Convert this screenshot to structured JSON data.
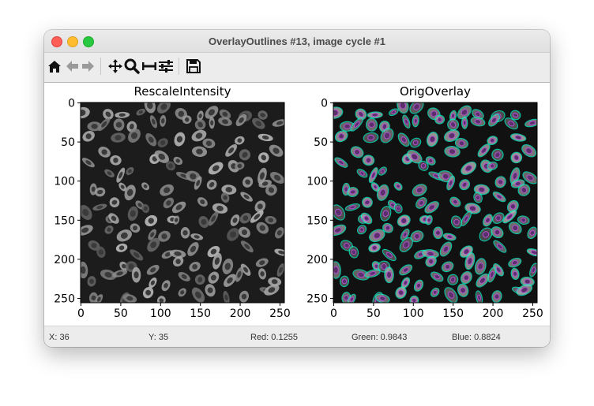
{
  "window": {
    "title": "OverlayOutlines #13, image cycle #1"
  },
  "toolbar": {
    "buttons": [
      {
        "name": "home-icon",
        "label": "Home"
      },
      {
        "name": "back-icon",
        "label": "Back"
      },
      {
        "name": "forward-icon",
        "label": "Forward"
      },
      {
        "name": "pan-icon",
        "label": "Pan"
      },
      {
        "name": "zoom-icon",
        "label": "Zoom"
      },
      {
        "name": "subplots-icon",
        "label": "Subplots"
      },
      {
        "name": "customize-icon",
        "label": "Customize"
      },
      {
        "name": "save-icon",
        "label": "Save"
      }
    ]
  },
  "plots": [
    {
      "title": "RescaleIntensity",
      "xticks": [
        "0",
        "50",
        "100",
        "150",
        "200",
        "250"
      ],
      "yticks": [
        "0",
        "50",
        "100",
        "150",
        "200",
        "250"
      ]
    },
    {
      "title": "OrigOverlay",
      "xticks": [
        "0",
        "50",
        "100",
        "150",
        "200",
        "250"
      ],
      "yticks": [
        "0",
        "50",
        "100",
        "150",
        "200",
        "250"
      ]
    }
  ],
  "status": {
    "x": "X: 36",
    "y": "Y: 35",
    "red": "Red: 0.1255",
    "green": "Green: 0.9843",
    "blue": "Blue: 0.8824"
  },
  "colors": {
    "outline": "#00ffd5",
    "nucleus": "#b050d0",
    "cell_gray": "#8a8a8a"
  }
}
